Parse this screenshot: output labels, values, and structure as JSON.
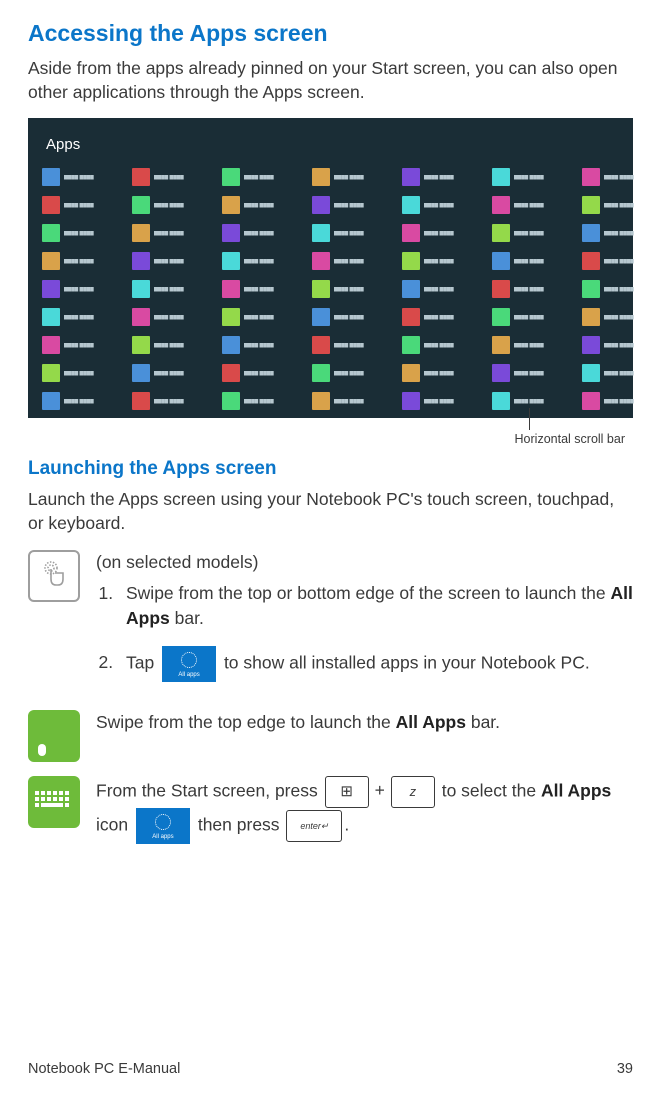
{
  "title_accessing": "Accessing the Apps screen",
  "intro": "Aside from the apps already pinned on your Start screen, you can also open other applications through the Apps screen.",
  "apps_header": "Apps",
  "scroll_label": "Horizontal scroll bar",
  "title_launching": "Launching the Apps screen",
  "launch_intro": "Launch the Apps screen using your Notebook PC's touch screen, touchpad, or keyboard.",
  "touch": {
    "note": "(on selected models)",
    "step1_a": "Swipe from the top or bottom edge of the screen to launch the ",
    "step1_b": "All Apps",
    "step1_c": " bar.",
    "step2_a": "Tap ",
    "step2_b": " to show all installed apps in your Notebook PC.",
    "tile_label": "All apps"
  },
  "touchpad": {
    "text_a": "Swipe from the top edge to launch the ",
    "text_b": "All Apps",
    "text_c": " bar."
  },
  "keyboard": {
    "text_a": "From the Start screen, press ",
    "key_z": "z",
    "text_b": " to select the ",
    "text_c": "All Apps",
    "text_d": " icon ",
    "text_e": " then press ",
    "text_f": ".",
    "tile_label": "All apps"
  },
  "footer_left": "Notebook PC E-Manual",
  "footer_right": "39"
}
